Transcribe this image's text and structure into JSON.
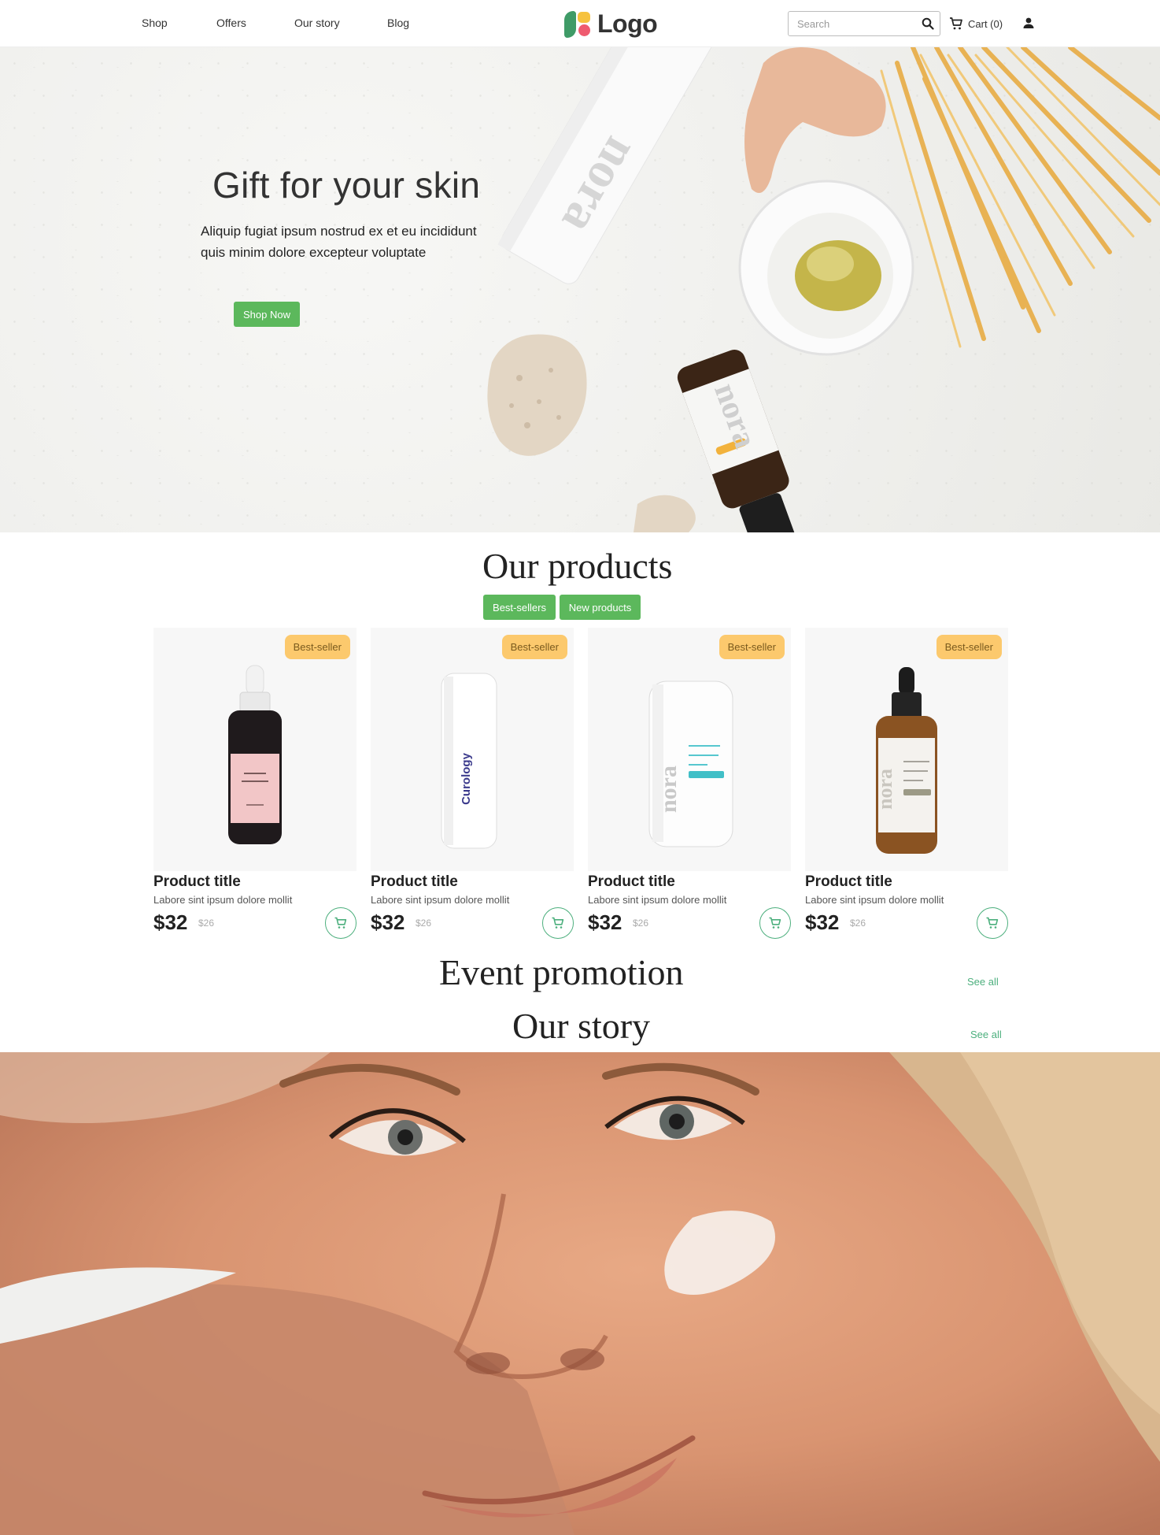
{
  "header": {
    "nav": [
      {
        "label": "Shop"
      },
      {
        "label": "Offers"
      },
      {
        "label": "Our story"
      },
      {
        "label": "Blog"
      }
    ],
    "logo_text": "Logo",
    "search_placeholder": "Search",
    "cart_label": "Cart (0)",
    "icons": {
      "search": "search-icon",
      "cart": "cart-icon",
      "user": "user-icon"
    }
  },
  "hero": {
    "title": "Gift for your skin",
    "subtitle_line1": "Aliquip fugiat ipsum nostrud ex et eu incididunt",
    "subtitle_line2": "quis minim dolore excepteur voluptate",
    "button": "Shop Now",
    "product_brand": "nora"
  },
  "products": {
    "title": "Our products",
    "tabs": [
      {
        "label": "Best-sellers"
      },
      {
        "label": "New products"
      }
    ],
    "items": [
      {
        "badge": "Best-seller",
        "title": "Product title",
        "desc": "Labore sint ipsum dolore mollit",
        "price": "$32",
        "old_price": "$26",
        "kind": "pink-dropper-bottle"
      },
      {
        "badge": "Best-seller",
        "title": "Product title",
        "desc": "Labore sint ipsum dolore mollit",
        "price": "$32",
        "old_price": "$26",
        "kind": "white-tube",
        "brand": "Curology"
      },
      {
        "badge": "Best-seller",
        "title": "Product title",
        "desc": "Labore sint ipsum dolore mollit",
        "price": "$32",
        "old_price": "$26",
        "kind": "cream-jar",
        "brand": "nora"
      },
      {
        "badge": "Best-seller",
        "title": "Product title",
        "desc": "Labore sint ipsum dolore mollit",
        "price": "$32",
        "old_price": "$26",
        "kind": "amber-dropper-bottle",
        "brand": "nora"
      }
    ]
  },
  "event": {
    "title": "Event promotion",
    "see_all": "See all"
  },
  "story": {
    "title": "Our story",
    "see_all": "See all"
  },
  "colors": {
    "accent_green": "#5cb85c",
    "badge_yellow": "#fcc96d",
    "link_green": "#4caf7d"
  }
}
